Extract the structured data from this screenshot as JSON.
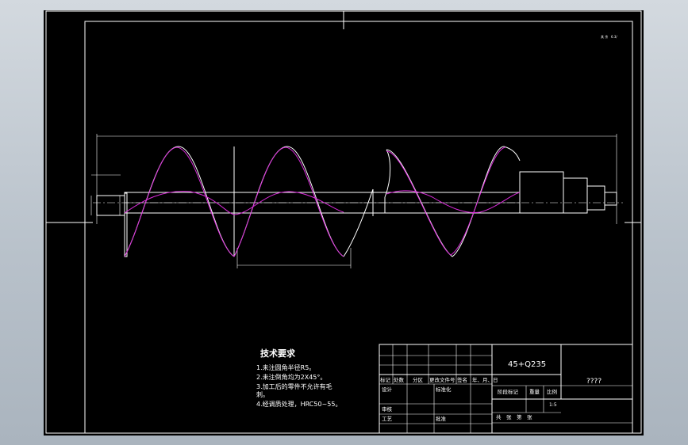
{
  "drawing": {
    "material": "45+Q235",
    "drawing_name": "????",
    "scale": "1:5",
    "top_right_mark_a": "其 余",
    "top_right_mark_b": "6.3/",
    "technical_requirements": {
      "title": "技术要求",
      "items": [
        "1.未注圆角半径R5。",
        "2.未注倒角均为2X45°。",
        "3.加工后的零件不允许有毛",
        "刺。",
        "4.经调质处理，HRC50~55。"
      ]
    },
    "title_block": {
      "row_labels": [
        "标记",
        "处数",
        "分区",
        "更改文件号",
        "签名",
        "年、月、日"
      ],
      "design": "设计",
      "standardize": "标准化",
      "review": "审核",
      "process": "工艺",
      "approve": "批准",
      "stage_mark": "阶段标记",
      "weight": "重量",
      "scale_label": "比例",
      "sheet_info": "共　张　第　张"
    }
  }
}
